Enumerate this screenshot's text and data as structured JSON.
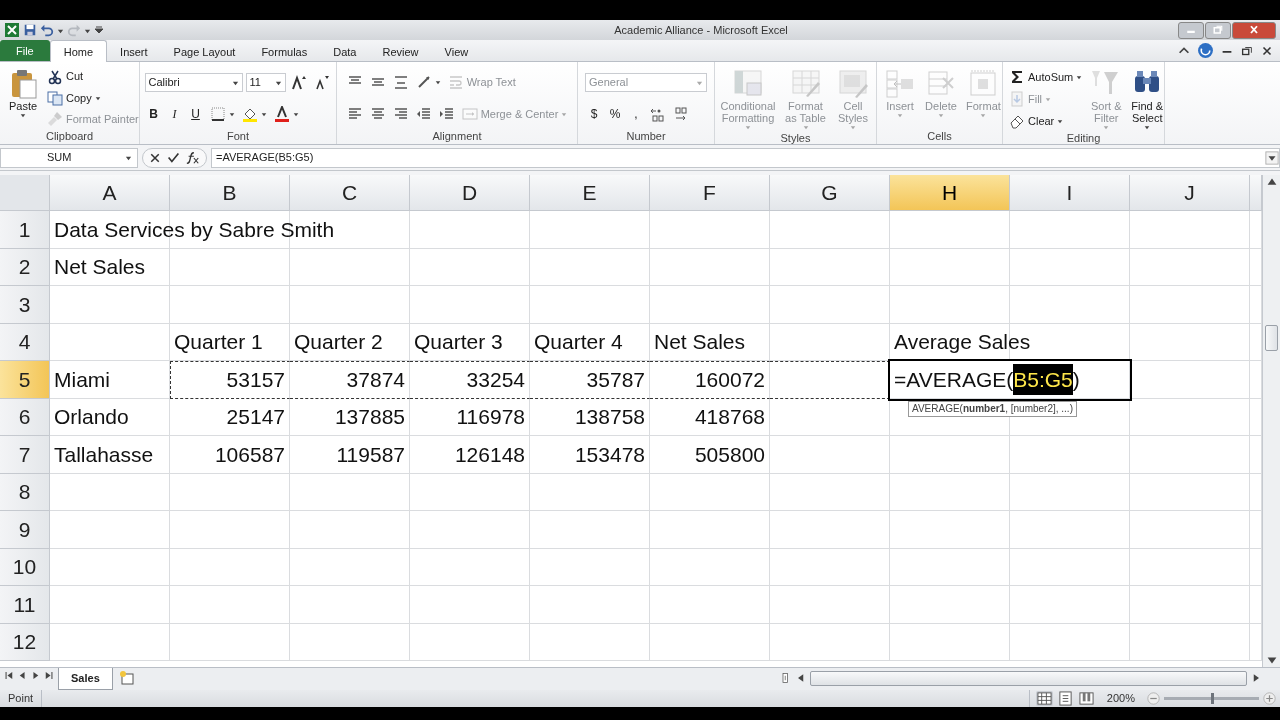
{
  "window": {
    "title": "Academic Alliance  -  Microsoft Excel"
  },
  "tabs": [
    {
      "label": "File",
      "kind": "file",
      "selected": false
    },
    {
      "label": "Home",
      "kind": "tab",
      "selected": true
    },
    {
      "label": "Insert",
      "kind": "tab",
      "selected": false
    },
    {
      "label": "Page Layout",
      "kind": "tab",
      "selected": false
    },
    {
      "label": "Formulas",
      "kind": "tab",
      "selected": false
    },
    {
      "label": "Data",
      "kind": "tab",
      "selected": false
    },
    {
      "label": "Review",
      "kind": "tab",
      "selected": false
    },
    {
      "label": "View",
      "kind": "tab",
      "selected": false
    }
  ],
  "ribbon": {
    "groups": [
      {
        "label": "Clipboard",
        "blocks": [
          {
            "kind": "large",
            "label": "Paste",
            "caret": true,
            "disabled": false
          },
          {
            "kind": "stack",
            "rows": [
              {
                "items": [
                  {
                    "kind": "small",
                    "label": "Cut",
                    "caret": false,
                    "disabled": false
                  }
                ]
              },
              {
                "items": [
                  {
                    "kind": "small",
                    "label": "Copy",
                    "caret": true,
                    "disabled": false
                  }
                ]
              },
              {
                "items": [
                  {
                    "kind": "small",
                    "label": "Format Painter",
                    "caret": false,
                    "disabled": true
                  }
                ]
              }
            ]
          }
        ]
      },
      {
        "label": "Font",
        "blocks": [
          {
            "kind": "stack",
            "rows": [
              {
                "items": [
                  {
                    "kind": "combo",
                    "label": "Calibri",
                    "disabled": false
                  },
                  {
                    "kind": "combo",
                    "label": "11",
                    "disabled": false
                  },
                  {
                    "kind": "icon",
                    "caret": false,
                    "disabled": false
                  },
                  {
                    "kind": "icon",
                    "caret": false,
                    "disabled": false
                  }
                ]
              },
              {
                "items": [
                  {
                    "kind": "bold",
                    "label": "B",
                    "disabled": false
                  },
                  {
                    "kind": "italic",
                    "label": "I",
                    "disabled": false
                  },
                  {
                    "kind": "underline",
                    "label": "U",
                    "disabled": false
                  },
                  {
                    "kind": "icon",
                    "caret": true,
                    "disabled": false
                  },
                  {
                    "kind": "icon",
                    "caret": true,
                    "disabled": false
                  },
                  {
                    "kind": "icon",
                    "caret": true,
                    "disabled": false
                  }
                ]
              }
            ]
          }
        ]
      },
      {
        "label": "Alignment",
        "blocks": [
          {
            "kind": "stack",
            "rows": [
              {
                "items": [
                  {
                    "kind": "icon",
                    "caret": false,
                    "disabled": false
                  },
                  {
                    "kind": "icon",
                    "caret": false,
                    "disabled": false
                  },
                  {
                    "kind": "icon",
                    "caret": false,
                    "disabled": false
                  },
                  {
                    "kind": "icon",
                    "caret": true,
                    "disabled": false
                  },
                  {
                    "kind": "small",
                    "label": "Wrap Text",
                    "caret": false,
                    "disabled": true
                  }
                ]
              },
              {
                "items": [
                  {
                    "kind": "icon",
                    "caret": false,
                    "disabled": false
                  },
                  {
                    "kind": "icon",
                    "caret": false,
                    "disabled": false
                  },
                  {
                    "kind": "icon",
                    "caret": false,
                    "disabled": false
                  },
                  {
                    "kind": "icon",
                    "caret": false,
                    "disabled": false
                  },
                  {
                    "kind": "icon",
                    "caret": false,
                    "disabled": false
                  },
                  {
                    "kind": "small",
                    "label": "Merge & Center",
                    "caret": true,
                    "disabled": true
                  }
                ]
              }
            ]
          }
        ]
      },
      {
        "label": "Number",
        "blocks": [
          {
            "kind": "stack",
            "rows": [
              {
                "items": [
                  {
                    "kind": "combo",
                    "label": "General",
                    "disabled": true
                  }
                ]
              },
              {
                "items": [
                  {
                    "kind": "symbol",
                    "label": "$",
                    "disabled": false
                  },
                  {
                    "kind": "symbol",
                    "label": "%",
                    "disabled": false
                  },
                  {
                    "kind": "symbol",
                    "label": ",",
                    "disabled": false
                  },
                  {
                    "kind": "icon",
                    "caret": false,
                    "disabled": false
                  },
                  {
                    "kind": "icon",
                    "caret": false,
                    "disabled": false
                  }
                ]
              }
            ]
          }
        ]
      },
      {
        "label": "Styles",
        "blocks": [
          {
            "kind": "large",
            "label": "Conditional Formatting",
            "caret": true,
            "disabled": true
          },
          {
            "kind": "large",
            "label": "Format as Table",
            "caret": true,
            "disabled": true
          },
          {
            "kind": "large",
            "label": "Cell Styles",
            "caret": true,
            "disabled": true
          }
        ]
      },
      {
        "label": "Cells",
        "blocks": [
          {
            "kind": "large",
            "label": "Insert",
            "caret": true,
            "disabled": true
          },
          {
            "kind": "large",
            "label": "Delete",
            "caret": true,
            "disabled": true
          },
          {
            "kind": "large",
            "label": "Format",
            "caret": true,
            "disabled": true
          }
        ]
      },
      {
        "label": "Editing",
        "blocks": [
          {
            "kind": "stack",
            "rows": [
              {
                "items": [
                  {
                    "kind": "small",
                    "label": "AutoSum",
                    "caret": true,
                    "disabled": false
                  }
                ]
              },
              {
                "items": [
                  {
                    "kind": "small",
                    "label": "Fill",
                    "caret": true,
                    "disabled": true
                  }
                ]
              },
              {
                "items": [
                  {
                    "kind": "small",
                    "label": "Clear",
                    "caret": true,
                    "disabled": false
                  }
                ]
              }
            ]
          },
          {
            "kind": "large",
            "label": "Sort & Filter",
            "caret": true,
            "disabled": true
          },
          {
            "kind": "large",
            "label": "Find & Select",
            "caret": true,
            "disabled": false
          }
        ]
      }
    ]
  },
  "formula_bar": {
    "name_box": "SUM",
    "formula": "=AVERAGE(B5:G5)"
  },
  "columns": [
    {
      "label": "A",
      "selected": false
    },
    {
      "label": "B",
      "selected": false
    },
    {
      "label": "C",
      "selected": false
    },
    {
      "label": "D",
      "selected": false
    },
    {
      "label": "E",
      "selected": false
    },
    {
      "label": "F",
      "selected": false
    },
    {
      "label": "G",
      "selected": false
    },
    {
      "label": "H",
      "selected": true
    },
    {
      "label": "I",
      "selected": false
    },
    {
      "label": "J",
      "selected": false
    }
  ],
  "rows": [
    {
      "label": "1",
      "selected": false,
      "marquee": false,
      "cells": [
        {
          "kind": "text",
          "text": "Data Services by Sabre Smith"
        },
        null,
        null,
        null,
        null,
        null,
        null,
        null,
        null,
        null
      ]
    },
    {
      "label": "2",
      "selected": false,
      "marquee": false,
      "cells": [
        {
          "kind": "text",
          "text": "Net Sales"
        },
        null,
        null,
        null,
        null,
        null,
        null,
        null,
        null,
        null
      ]
    },
    {
      "label": "3",
      "selected": false,
      "marquee": false,
      "cells": [
        null,
        null,
        null,
        null,
        null,
        null,
        null,
        null,
        null,
        null
      ]
    },
    {
      "label": "4",
      "selected": false,
      "marquee": false,
      "cells": [
        null,
        {
          "kind": "text",
          "text": "Quarter 1"
        },
        {
          "kind": "text",
          "text": "Quarter 2"
        },
        {
          "kind": "text",
          "text": "Quarter 3"
        },
        {
          "kind": "text",
          "text": "Quarter 4"
        },
        {
          "kind": "text",
          "text": "Net Sales"
        },
        null,
        {
          "kind": "text",
          "text": "Average Sales"
        },
        null,
        null
      ]
    },
    {
      "label": "5",
      "selected": true,
      "marquee": true,
      "cells": [
        {
          "kind": "text",
          "text": "Miami"
        },
        {
          "kind": "number",
          "text": "53157"
        },
        {
          "kind": "number",
          "text": "37874"
        },
        {
          "kind": "number",
          "text": "33254"
        },
        {
          "kind": "number",
          "text": "35787"
        },
        {
          "kind": "number",
          "text": "160072"
        },
        null,
        {
          "kind": "formula",
          "text_before": "=AVERAGE(",
          "reference": "B5:G5",
          "text_after": ")",
          "tooltip": "AVERAGE(**number1**, [number2], ...)"
        },
        null,
        null
      ]
    },
    {
      "label": "6",
      "selected": false,
      "marquee": false,
      "cells": [
        {
          "kind": "text",
          "text": "Orlando"
        },
        {
          "kind": "number",
          "text": "25147"
        },
        {
          "kind": "number",
          "text": "137885"
        },
        {
          "kind": "number",
          "text": "116978"
        },
        {
          "kind": "number",
          "text": "138758"
        },
        {
          "kind": "number",
          "text": "418768"
        },
        null,
        null,
        null,
        null
      ]
    },
    {
      "label": "7",
      "selected": false,
      "marquee": false,
      "cells": [
        {
          "kind": "text",
          "text": "Tallahasse"
        },
        {
          "kind": "number",
          "text": "106587"
        },
        {
          "kind": "number",
          "text": "119587"
        },
        {
          "kind": "number",
          "text": "126148"
        },
        {
          "kind": "number",
          "text": "153478"
        },
        {
          "kind": "number",
          "text": "505800"
        },
        null,
        null,
        null,
        null
      ]
    },
    {
      "label": "8",
      "selected": false,
      "marquee": false,
      "cells": [
        null,
        null,
        null,
        null,
        null,
        null,
        null,
        null,
        null,
        null
      ]
    },
    {
      "label": "9",
      "selected": false,
      "marquee": false,
      "cells": [
        null,
        null,
        null,
        null,
        null,
        null,
        null,
        null,
        null,
        null
      ]
    },
    {
      "label": "10",
      "selected": false,
      "marquee": false,
      "cells": [
        null,
        null,
        null,
        null,
        null,
        null,
        null,
        null,
        null,
        null
      ]
    },
    {
      "label": "11",
      "selected": false,
      "marquee": false,
      "cells": [
        null,
        null,
        null,
        null,
        null,
        null,
        null,
        null,
        null,
        null
      ]
    },
    {
      "label": "12",
      "selected": false,
      "marquee": false,
      "cells": [
        null,
        null,
        null,
        null,
        null,
        null,
        null,
        null,
        null,
        null
      ]
    }
  ],
  "sheet_tabs": [
    {
      "label": "Sales",
      "selected": true
    }
  ],
  "status_bar": {
    "mode": "Point",
    "view_buttons": [
      {
        "selected": true
      },
      {
        "selected": false
      },
      {
        "selected": false
      }
    ],
    "zoom": "200%",
    "zoom_slider": {
      "level": 0.5
    }
  }
}
